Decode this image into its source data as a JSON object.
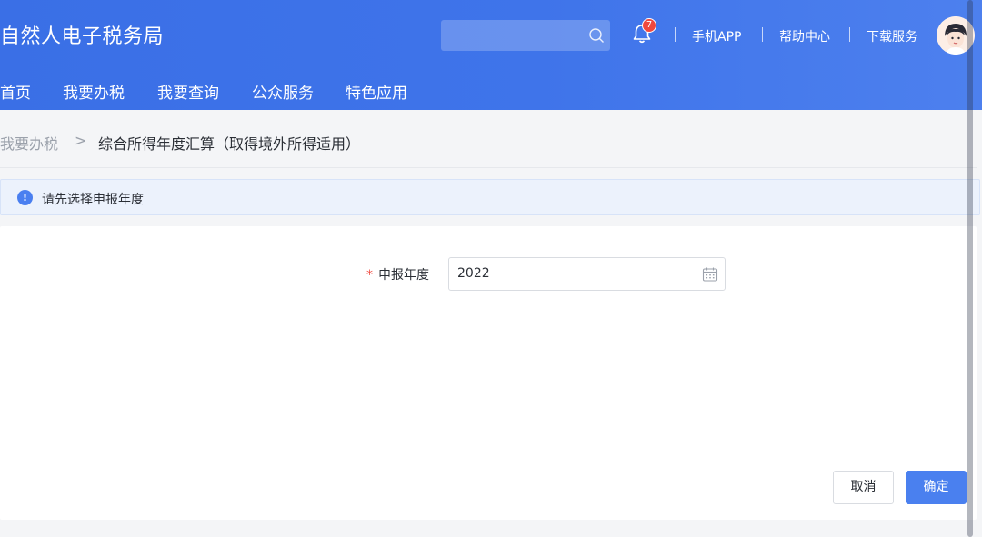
{
  "header": {
    "app_title": "自然人电子税务局",
    "search": {
      "value": "",
      "placeholder": ""
    },
    "notifications": {
      "count": "7"
    },
    "links": [
      {
        "label": "手机APP"
      },
      {
        "label": "帮助中心"
      },
      {
        "label": "下载服务"
      }
    ]
  },
  "main_nav": [
    {
      "label": "首页"
    },
    {
      "label": "我要办税"
    },
    {
      "label": "我要查询"
    },
    {
      "label": "公众服务"
    },
    {
      "label": "特色应用"
    }
  ],
  "breadcrumb": {
    "parent": "我要办税",
    "separator": ">",
    "current": "综合所得年度汇算（取得境外所得适用）"
  },
  "notice": {
    "icon": "info-icon",
    "icon_glyph": "!",
    "text": "请先选择申报年度"
  },
  "form": {
    "required_mark": "*",
    "year_label": "申报年度",
    "year_value": "2022"
  },
  "actions": {
    "cancel_label": "取消",
    "confirm_label": "确定"
  },
  "colors": {
    "header_blue": "#3f74ea",
    "accent": "#4a80ef",
    "badge_red": "#f0483e"
  }
}
